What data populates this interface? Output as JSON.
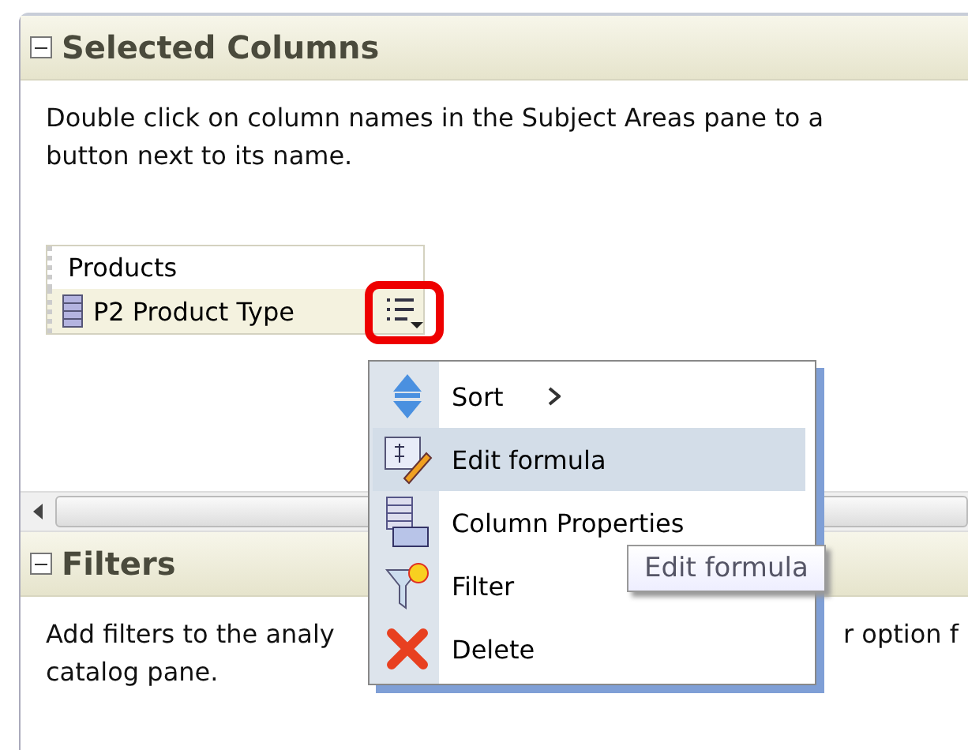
{
  "selected_columns": {
    "title": "Selected Columns",
    "expanded": true,
    "description": [
      "Double click on column names in the Subject Areas pane to a",
      "button next to its name."
    ],
    "folder": "Products",
    "columns": [
      {
        "name": "P2 Product Type",
        "menu_open": true
      }
    ]
  },
  "context_menu": {
    "items": [
      {
        "label": "Sort",
        "kind": "submenu",
        "selected": false
      },
      {
        "label": "Edit formula",
        "kind": "action",
        "selected": true
      },
      {
        "label": "Column Properties",
        "kind": "action",
        "selected": false
      },
      {
        "label": "Filter",
        "kind": "action",
        "selected": false
      },
      {
        "label": "Delete",
        "kind": "action",
        "selected": false
      }
    ]
  },
  "tooltip": "Edit formula",
  "filters": {
    "title": "Filters",
    "expanded": true,
    "description_lines": [
      [
        "Add filters to the analy",
        "r option f"
      ],
      [
        "catalog pane."
      ]
    ]
  }
}
